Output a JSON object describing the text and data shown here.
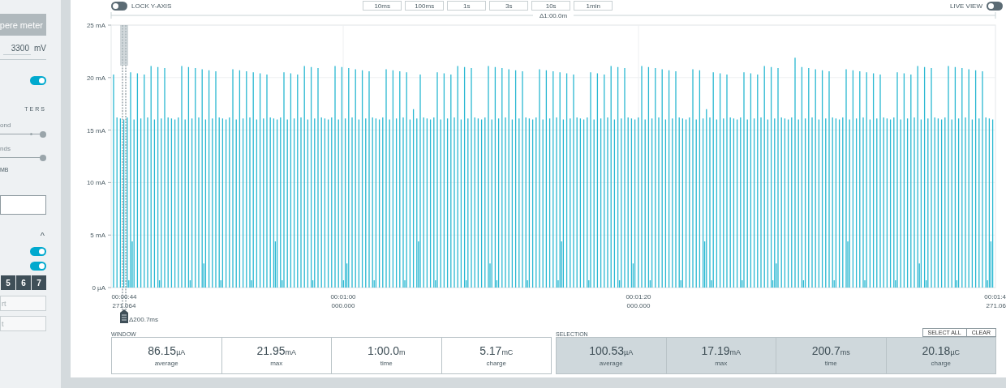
{
  "sidebar": {
    "mode_button": "pere meter",
    "voltage": {
      "value": "3300",
      "unit": "mV"
    },
    "toggle": {
      "on": true
    },
    "section_heading": "TERS",
    "sliders": [
      {
        "label": "ond",
        "level": 1
      },
      {
        "label": "nds",
        "level": 1
      }
    ],
    "buffer_text": "MB",
    "collapse_icon": "^",
    "toggles": [
      {
        "on": true
      },
      {
        "on": true
      }
    ],
    "channel_buttons": [
      "5",
      "6",
      "7"
    ],
    "fields": [
      {
        "placeholder": "rt"
      },
      {
        "placeholder": "t"
      }
    ]
  },
  "toolbar": {
    "lock_y_axis": {
      "label": "LOCK Y-AXIS",
      "on": false
    },
    "zoom_buttons": [
      "10ms",
      "100ms",
      "1s",
      "3s",
      "10s",
      "1min"
    ],
    "live_view": {
      "label": "LIVE VIEW",
      "on": false
    }
  },
  "chart": {
    "range_label": "Δ1:00.0m",
    "y_labels": [
      "25 mA",
      "20 mA",
      "15 mA",
      "10 mA",
      "5 mA",
      "0 µA"
    ],
    "x_labels": [
      {
        "time": "00:00:44",
        "sub": "271.064"
      },
      {
        "time": "00:01:00",
        "sub": "000.000"
      },
      {
        "time": "00:01:20",
        "sub": "000.000"
      },
      {
        "time": "00:01:4",
        "sub": "271.06"
      }
    ],
    "cursor_label": "Δ200.7ms"
  },
  "window_stats": {
    "heading": "WINDOW",
    "items": [
      {
        "value": "86.15",
        "unit": "µA",
        "label": "average"
      },
      {
        "value": "21.95",
        "unit": "mA",
        "label": "max"
      },
      {
        "value": "1:00.0",
        "unit": "m",
        "label": "time"
      },
      {
        "value": "5.17",
        "unit": "mC",
        "label": "charge"
      }
    ]
  },
  "selection_stats": {
    "heading": "SELECTION",
    "buttons": [
      "SELECT ALL",
      "CLEAR"
    ],
    "items": [
      {
        "value": "100.53",
        "unit": "µA",
        "label": "average"
      },
      {
        "value": "17.19",
        "unit": "mA",
        "label": "max"
      },
      {
        "value": "200.7",
        "unit": "ms",
        "label": "time"
      },
      {
        "value": "20.18",
        "unit": "µC",
        "label": "charge"
      }
    ]
  }
}
